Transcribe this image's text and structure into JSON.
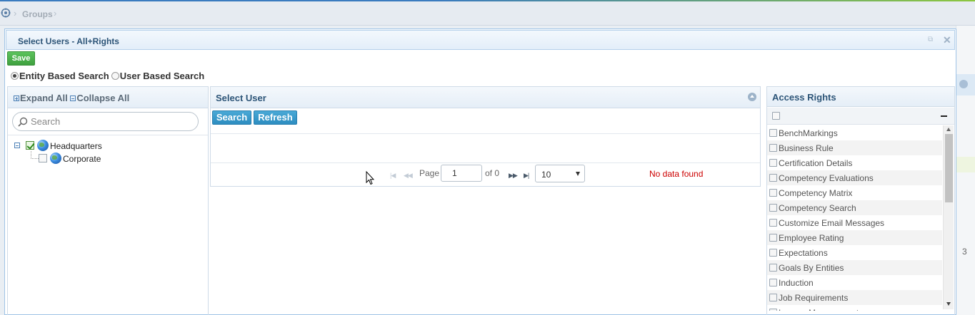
{
  "breadcrumb": {
    "current": "Groups"
  },
  "modal": {
    "title": "Select Users - All+Rights"
  },
  "toolbar": {
    "save_label": "Save"
  },
  "search_mode": {
    "options": [
      {
        "label": "Entity Based Search",
        "selected": true
      },
      {
        "label": "User Based Search",
        "selected": false
      }
    ]
  },
  "tree": {
    "expand_all": "Expand All",
    "collapse_all": "Collapse All",
    "search_placeholder": "Search",
    "nodes": [
      {
        "label": "Headquarters",
        "checked": true
      },
      {
        "label": "Corporate",
        "checked": false
      }
    ]
  },
  "users": {
    "title": "Select User",
    "search_label": "Search",
    "refresh_label": "Refresh",
    "pager": {
      "page_label": "Page",
      "page_value": "1",
      "of_label": "of 0",
      "page_size": "10",
      "message": "No data found"
    }
  },
  "rights": {
    "title": "Access Rights",
    "items": [
      "BenchMarkings",
      "Business Rule",
      "Certification Details",
      "Competency Evaluations",
      "Competency Matrix",
      "Competency Search",
      "Customize Email Messages",
      "Employee Rating",
      "Expectations",
      "Goals By Entities",
      "Induction",
      "Job Requirements",
      "Lesson Management"
    ]
  },
  "background": {
    "row_number": "3"
  },
  "colors": {
    "save_green": "#4cae4c",
    "action_blue": "#2d8dc0",
    "error_red": "#cc0000",
    "header_text": "#2d5578"
  }
}
